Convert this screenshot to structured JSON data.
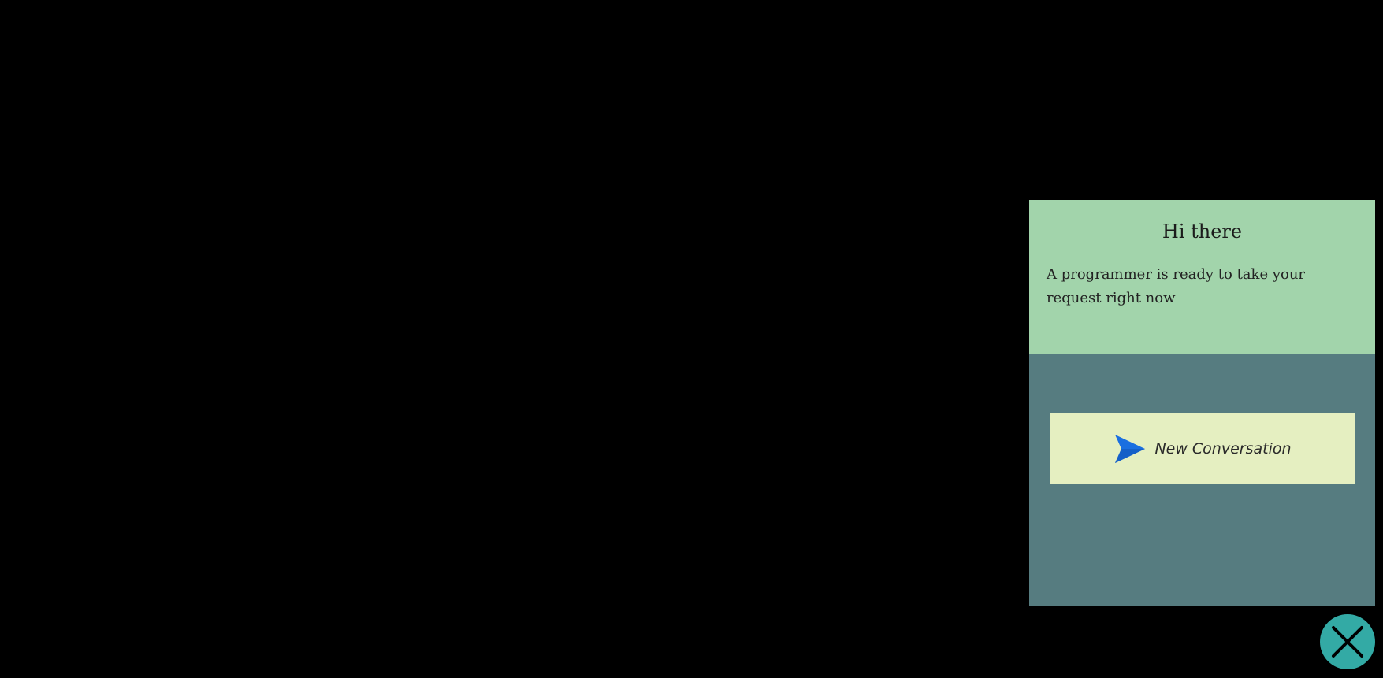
{
  "chat": {
    "title": "Hi there",
    "subtitle": "A programmer is ready to take your request right now",
    "new_conversation_label": "New Conversation",
    "send_icon": "send-icon",
    "close_icon": "close-icon"
  },
  "colors": {
    "background": "#000000",
    "header_bg": "#a2d4ab",
    "body_bg": "#567c80",
    "button_bg": "#e5efc1",
    "send_icon": "#1a6fe0",
    "close_button_bg": "#33aaa5"
  }
}
